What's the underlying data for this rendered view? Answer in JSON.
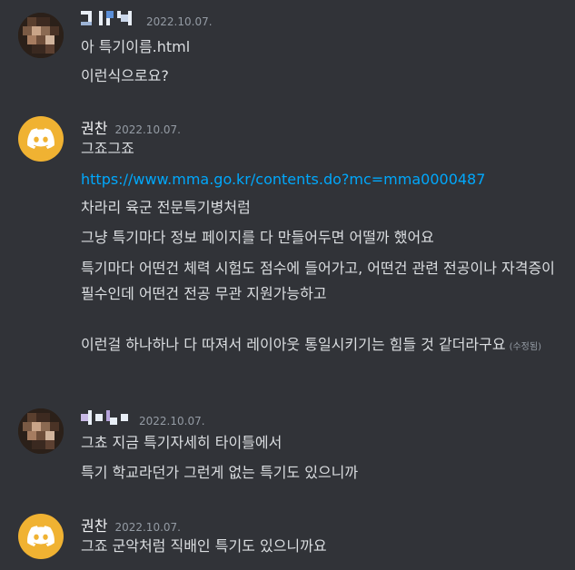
{
  "groups": [
    {
      "avatar": "pixelated-avatar",
      "username": "",
      "timestamp": "2022.10.07.",
      "messages": [
        "아 특기이름.html",
        "이런식으로요?"
      ]
    },
    {
      "avatar": "discord-logo-icon",
      "username": "권찬",
      "timestamp": "2022.10.07.",
      "messages": [
        "그죠그죠",
        "https://www.mma.go.kr/contents.do?mc=mma0000487",
        "차라리 육군 전문특기병처럼",
        "그냥 특기마다 정보 페이지를 다 만들어두면 어떨까 했어요",
        "특기마다 어떤건 체력 시험도 점수에 들어가고, 어떤건 관련 전공이나 자격증이 필수인데 어떤건 전공 무관 지원가능하고",
        "이런걸 하나하나 다 따져서 레이아웃 통일시키기는 힘들 것 같더라구요"
      ],
      "edited_label": "(수정됨)"
    },
    {
      "avatar": "pixelated-avatar",
      "username": "",
      "timestamp": "2022.10.07.",
      "messages": [
        "그쵸 지금 특기자세히 타이틀에서",
        "특기 학교라던가 그런게 없는 특기도 있으니까"
      ]
    },
    {
      "avatar": "discord-logo-icon",
      "username": "권찬",
      "timestamp": "2022.10.07.",
      "messages": [
        "그죠 군악처럼 직배인 특기도 있으니까요"
      ]
    }
  ],
  "colors": {
    "background": "#313338",
    "text": "#dbdee1",
    "username": "#f2f3f5",
    "timestamp": "#949ba4",
    "link": "#00a8fc",
    "discord_avatar": "#f0b232"
  }
}
